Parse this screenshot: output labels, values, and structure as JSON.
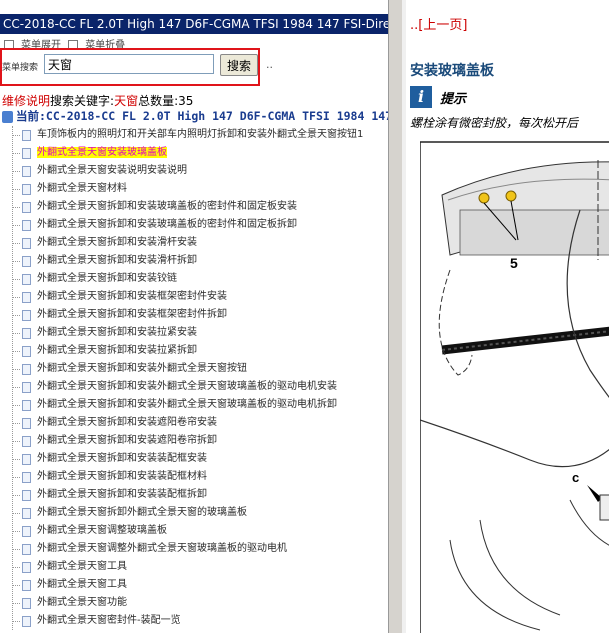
{
  "window": {
    "title": "CC-2018-CC FL 2.0T High 147 D6F-CGMA TFSI 1984 147 FSI-Direkt"
  },
  "menu": {
    "expand_all": "菜单展开",
    "collapse_all": "菜单折叠"
  },
  "search": {
    "label": "菜单搜索",
    "value": "天窗",
    "button": "搜索",
    "extra": ".."
  },
  "result_info": {
    "prefix": "维修说明",
    "keyword_label": "搜索关键字:",
    "keyword": "天窗",
    "count_label": "总数量:",
    "count": "35"
  },
  "current": {
    "text": "当前:CC-2018-CC FL 2.0T High 147 D6F-CGMA TFSI 1984 147"
  },
  "tree_items": [
    "车顶饰板内的照明灯和开关部车内照明灯拆卸和安装外翻式全景天窗按钮1",
    "外翻式全景天窗安装玻璃盖板",
    "外翻式全景天窗安装说明安装说明",
    "外翻式全景天窗材料",
    "外翻式全景天窗拆卸和安装玻璃盖板的密封件和固定板安装",
    "外翻式全景天窗拆卸和安装玻璃盖板的密封件和固定板拆卸",
    "外翻式全景天窗拆卸和安装滑杆安装",
    "外翻式全景天窗拆卸和安装滑杆拆卸",
    "外翻式全景天窗拆卸和安装铰链",
    "外翻式全景天窗拆卸和安装框架密封件安装",
    "外翻式全景天窗拆卸和安装框架密封件拆卸",
    "外翻式全景天窗拆卸和安装拉紧安装",
    "外翻式全景天窗拆卸和安装拉紧拆卸",
    "外翻式全景天窗拆卸和安装外翻式全景天窗按钮",
    "外翻式全景天窗拆卸和安装外翻式全景天窗玻璃盖板的驱动电机安装",
    "外翻式全景天窗拆卸和安装外翻式全景天窗玻璃盖板的驱动电机拆卸",
    "外翻式全景天窗拆卸和安装遮阳卷帘安装",
    "外翻式全景天窗拆卸和安装遮阳卷帘拆卸",
    "外翻式全景天窗拆卸和安装装配框安装",
    "外翻式全景天窗拆卸和安装装配框材料",
    "外翻式全景天窗拆卸和安装装配框拆卸",
    "外翻式全景天窗拆卸外翻式全景天窗的玻璃盖板",
    "外翻式全景天窗调整玻璃盖板",
    "外翻式全景天窗调整外翻式全景天窗玻璃盖板的驱动电机",
    "外翻式全景天窗工具",
    "外翻式全景天窗工具",
    "外翻式全景天窗功能",
    "外翻式全景天窗密封件-装配一览"
  ],
  "selected_index": 1,
  "right": {
    "prev_link": "..[上一页]",
    "section_title": "安装玻璃盖板",
    "tip_label": "提示",
    "tip_text": "螺栓涂有微密封胶，每次松开后",
    "figure_labels": {
      "callout_5": "5",
      "callout_c": "c"
    }
  },
  "colors": {
    "title_bg": "#0a246a",
    "highlight_border": "#e0141a",
    "selected_bg": "#ffff00",
    "selected_text": "#e000c0"
  }
}
